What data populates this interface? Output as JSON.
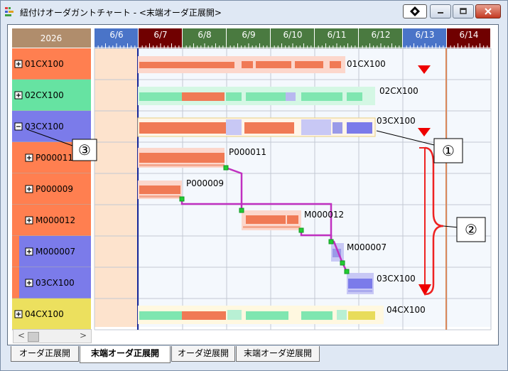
{
  "window": {
    "title": "紐付けオーダガントチャート - <末端オーダ正展開>"
  },
  "gantt": {
    "year": "2026",
    "dates": [
      "6/6",
      "6/7",
      "6/8",
      "6/9",
      "6/10",
      "6/11",
      "6/12",
      "6/13",
      "6/14"
    ],
    "date_colors": [
      "#4a74c8",
      "#700000",
      "#4a7a40",
      "#4a7a40",
      "#4a7a40",
      "#4a7a40",
      "#4a7a40",
      "#4a74c8",
      "#700000"
    ],
    "rows": [
      {
        "label": "01CX100",
        "indent": 0,
        "toggle": "⊞",
        "color": "#ff7f50"
      },
      {
        "label": "02CX100",
        "indent": 0,
        "toggle": "⊞",
        "color": "#66e3a2"
      },
      {
        "label": "03CX100",
        "indent": 0,
        "toggle": "⊟",
        "color": "#7b7bea"
      },
      {
        "label": "P000011",
        "indent": 1,
        "toggle": "⊞",
        "color": "#ff7f50"
      },
      {
        "label": "P000009",
        "indent": 1,
        "toggle": "⊞",
        "color": "#ff7f50"
      },
      {
        "label": "M000012",
        "indent": 1,
        "toggle": "⊞",
        "color": "#ff7f50"
      },
      {
        "label": "M000007",
        "indent": 1,
        "toggle": "⊞",
        "color": "#7b7bea"
      },
      {
        "label": "03CX100",
        "indent": 1,
        "toggle": "⊞",
        "color": "#7b7bea"
      },
      {
        "label": "04CX100",
        "indent": 0,
        "toggle": "⊞",
        "color": "#ece05e"
      }
    ],
    "bar_labels": [
      "01CX100",
      "02CX100",
      "03CX100",
      "P000011",
      "P000009",
      "M000012",
      "M000007",
      "03CX100",
      "04CX100"
    ]
  },
  "callouts": [
    "①",
    "②",
    "③"
  ],
  "scrollbar": {
    "left": "<",
    "right": ">"
  },
  "tabs": [
    {
      "label": "オーダ正展開",
      "active": false
    },
    {
      "label": "末端オーダ正展開",
      "active": true
    },
    {
      "label": "オーダ逆展開",
      "active": false
    },
    {
      "label": "末端オーダ逆展開",
      "active": false
    }
  ]
}
